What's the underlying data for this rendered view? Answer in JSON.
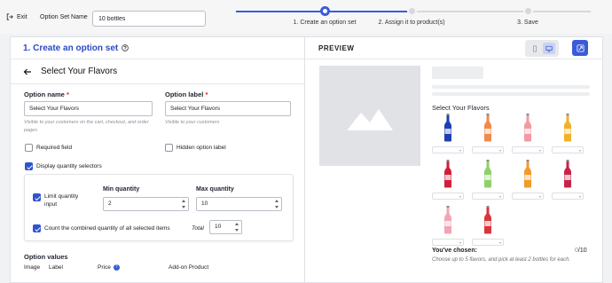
{
  "topbar": {
    "exit_label": "Exit",
    "set_name_label": "Option Set Name",
    "set_name_value": "10 bottles"
  },
  "steps": [
    {
      "label": "1. Create an option set",
      "status": "active"
    },
    {
      "label": "2. Assign it to product(s)",
      "status": "pending"
    },
    {
      "label": "3. Save",
      "status": "pending"
    }
  ],
  "left_panel": {
    "title": "1. Create an option set",
    "back_title": "Select Your Flavors",
    "option_name": {
      "label": "Option name",
      "required_mark": "*",
      "value": "Select Your Flavors",
      "hint": "Visible to your customers on the cart, checkout, and order pages"
    },
    "option_label": {
      "label": "Option label",
      "required_mark": "*",
      "value": "Select Your Flavors",
      "hint": "Visible to your customers"
    },
    "required_field": {
      "label": "Required field",
      "checked": false
    },
    "hidden_option_label": {
      "label": "Hidden option label",
      "checked": false
    },
    "display_quantity_selectors": {
      "label": "Display quantity selectors",
      "checked": true
    },
    "limit_quantity": {
      "label_line1": "Limit quantity",
      "label_line2": "input",
      "checked": true
    },
    "min_quantity": {
      "label": "Min quantity",
      "value": "2"
    },
    "max_quantity": {
      "label": "Max quantity",
      "value": "10"
    },
    "count_combined": {
      "label": "Count the combined quantity of all selected items",
      "checked": true
    },
    "total": {
      "label": "Total",
      "value": "10"
    },
    "option_values": {
      "title": "Option values",
      "columns": [
        "Image",
        "Label",
        "Price",
        "Add-on Product"
      ]
    }
  },
  "preview": {
    "title": "PREVIEW",
    "flavors_title": "Select Your Flavors",
    "bottle_colors": [
      "#1e3fb0",
      "#f08a4a",
      "#f29aa0",
      "#f2b12a",
      "#d11f3a",
      "#8fd06a",
      "#f39a2a",
      "#c8244a",
      "#f3a4b4",
      "#d8363a"
    ],
    "chosen_label": "You've chosen:",
    "chosen_count": "0",
    "chosen_max": "/10",
    "note": "Choose up to 5 flavors, and pick at least 2 bottles for each."
  },
  "colors": {
    "accent": "#3a5bd9",
    "title_blue": "#2b4ac6",
    "required_red": "#dd2222"
  }
}
